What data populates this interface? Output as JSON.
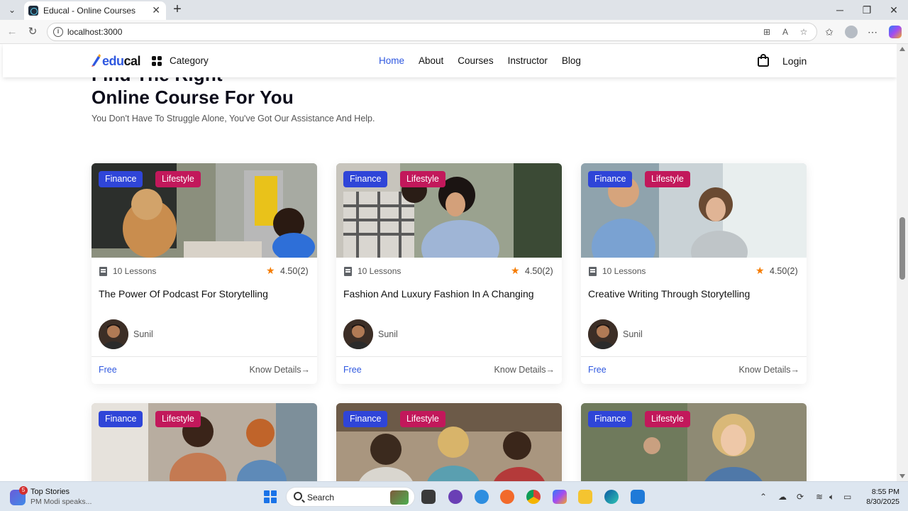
{
  "browser": {
    "tab_title": "Educal - Online Courses",
    "url": "localhost:3000"
  },
  "site": {
    "logo": {
      "part1": "edu",
      "part2": "cal"
    },
    "category_label": "Category",
    "menu": [
      "Home",
      "About",
      "Courses",
      "Instructor",
      "Blog"
    ],
    "active_menu": "Home",
    "login_label": "Login"
  },
  "hero": {
    "line1": "Find The Right",
    "line2": "Online Course For You",
    "subtitle": "You Don't Have To Struggle Alone, You've Got Our Assistance And Help."
  },
  "courses": [
    {
      "tags": [
        "Finance",
        "Lifestyle"
      ],
      "lessons": "10 Lessons",
      "rating": "4.50(2)",
      "title": "The Power Of Podcast For Storytelling",
      "author": "Sunil",
      "price": "Free",
      "details": "Know Details→"
    },
    {
      "tags": [
        "Finance",
        "Lifestyle"
      ],
      "lessons": "10 Lessons",
      "rating": "4.50(2)",
      "title": "Fashion And Luxury Fashion In A Changing",
      "author": "Sunil",
      "price": "Free",
      "details": "Know Details→"
    },
    {
      "tags": [
        "Finance",
        "Lifestyle"
      ],
      "lessons": "10 Lessons",
      "rating": "4.50(2)",
      "title": "Creative Writing Through Storytelling",
      "author": "Sunil",
      "price": "Free",
      "details": "Know Details→"
    },
    {
      "tags": [
        "Finance",
        "Lifestyle"
      ]
    },
    {
      "tags": [
        "Finance",
        "Lifestyle"
      ]
    },
    {
      "tags": [
        "Finance",
        "Lifestyle"
      ]
    }
  ],
  "taskbar": {
    "news_badge": "5",
    "news_title": "Top Stories",
    "news_subtitle": "PM Modi speaks...",
    "search_placeholder": "Search",
    "time": "8:55 PM",
    "date": "8/30/2025"
  },
  "colors": {
    "brand_blue": "#2f58e0",
    "tag_finance": "#2f45d8",
    "tag_lifestyle": "#c2185b",
    "star": "#f57c00"
  }
}
